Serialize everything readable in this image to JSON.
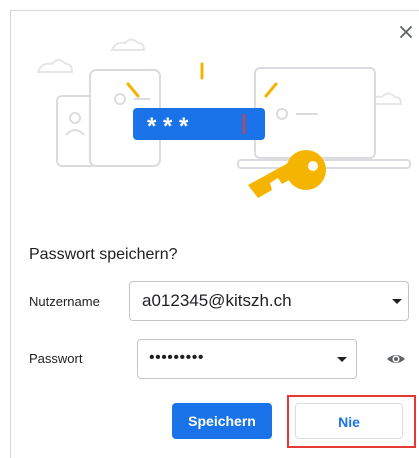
{
  "dialog": {
    "title": "Passwort speichern?",
    "close_icon": "close-icon"
  },
  "illustration": {
    "password_mask": "* * *",
    "icons": [
      "phone-icon",
      "tablet-icon",
      "laptop-icon",
      "key-icon",
      "cloud-icon"
    ]
  },
  "fields": {
    "username_label": "Nutzername",
    "username_value": "a012345@kitszh.ch",
    "password_label": "Passwort",
    "password_value": "•••••••••",
    "dropdown_icon": "chevron-down-icon",
    "eye_icon": "eye-icon"
  },
  "buttons": {
    "save_label": "Speichern",
    "never_label": "Nie"
  },
  "colors": {
    "accent": "#1a73e8",
    "key": "#f4b400",
    "highlight": "#e53935",
    "illustration_line": "#dadce0"
  }
}
